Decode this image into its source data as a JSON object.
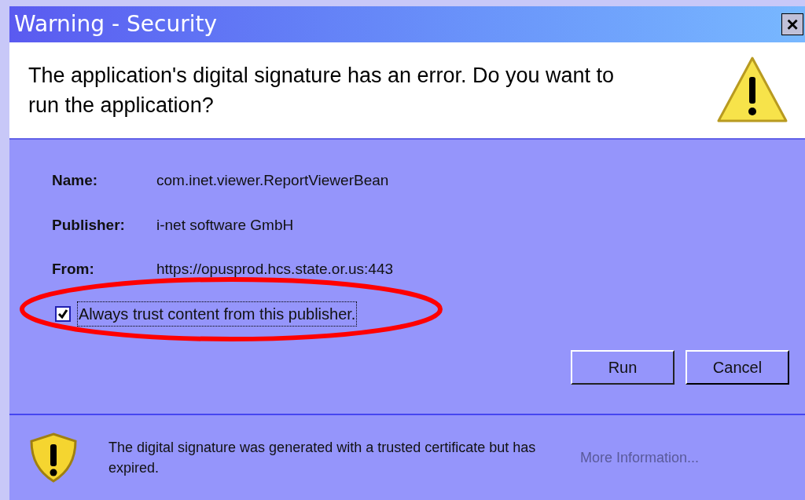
{
  "window": {
    "title": "Warning - Security",
    "close": "×"
  },
  "header": {
    "message": "The application's digital signature has an error.  Do you want to run the application?"
  },
  "details": [
    {
      "label": "Name:",
      "value": "com.inet.viewer.ReportViewerBean"
    },
    {
      "label": "Publisher:",
      "value": "i-net software GmbH"
    },
    {
      "label": "From:",
      "value": "https://opusprod.hcs.state.or.us:443"
    }
  ],
  "trust_checkbox": {
    "label": "Always trust content from this publisher.",
    "checked": true,
    "highlighted": true
  },
  "buttons": [
    "Run",
    "Cancel"
  ],
  "footer": {
    "message": "The digital signature was generated with a trusted certificate but has expired.",
    "link": "More Information..."
  }
}
